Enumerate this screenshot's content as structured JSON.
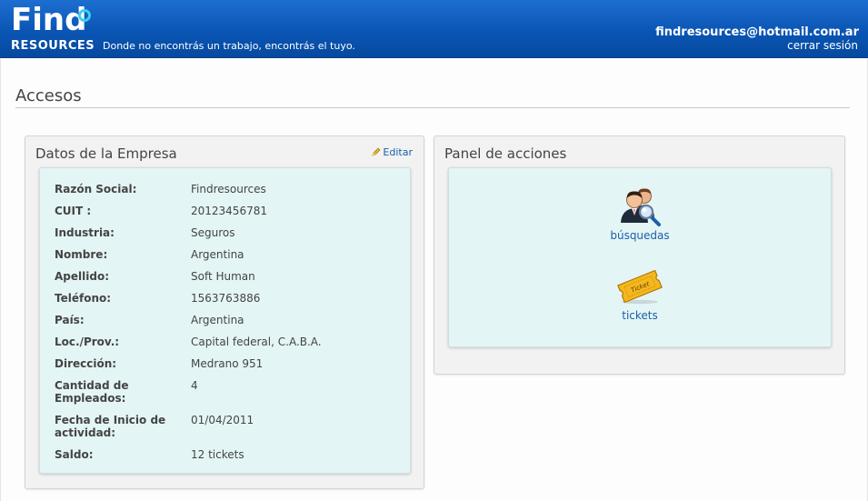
{
  "header": {
    "logo_top": "Find",
    "logo_bottom": "RESOURCES",
    "tagline": "Donde no encontrás un trabajo, encontrás el tuyo.",
    "user_email": "findresources@hotmail.com.ar",
    "logout_label": "cerrar sesión",
    "colors": {
      "bar": "#0a55b4",
      "logo_accent": "#38d0ef"
    }
  },
  "page": {
    "title": "Accesos"
  },
  "company_panel": {
    "title": "Datos de la Empresa",
    "edit_label": "Editar",
    "edit_icon": "pencil-icon",
    "fields": [
      {
        "label": "Razón Social:",
        "value": "Findresources"
      },
      {
        "label": "CUIT :",
        "value": "20123456781"
      },
      {
        "label": "Industria:",
        "value": "Seguros"
      },
      {
        "label": "Nombre:",
        "value": "Argentina"
      },
      {
        "label": "Apellido:",
        "value": "Soft Human"
      },
      {
        "label": "Teléfono:",
        "value": "1563763886"
      },
      {
        "label": "País:",
        "value": "Argentina"
      },
      {
        "label": "Loc./Prov.:",
        "value": "Capital federal, C.A.B.A."
      },
      {
        "label": "Dirección:",
        "value": "Medrano 951"
      },
      {
        "label": "Cantidad de Empleados:",
        "value": "4"
      },
      {
        "label": "Fecha de Inicio de actividad:",
        "value": "01/04/2011"
      },
      {
        "label": "Saldo:",
        "value": "12 tickets"
      }
    ]
  },
  "actions_panel": {
    "title": "Panel de acciones",
    "items": [
      {
        "label": "búsquedas",
        "icon": "users-search-icon"
      },
      {
        "label": "tickets",
        "icon": "ticket-icon",
        "icon_text": "Ticket"
      }
    ]
  }
}
